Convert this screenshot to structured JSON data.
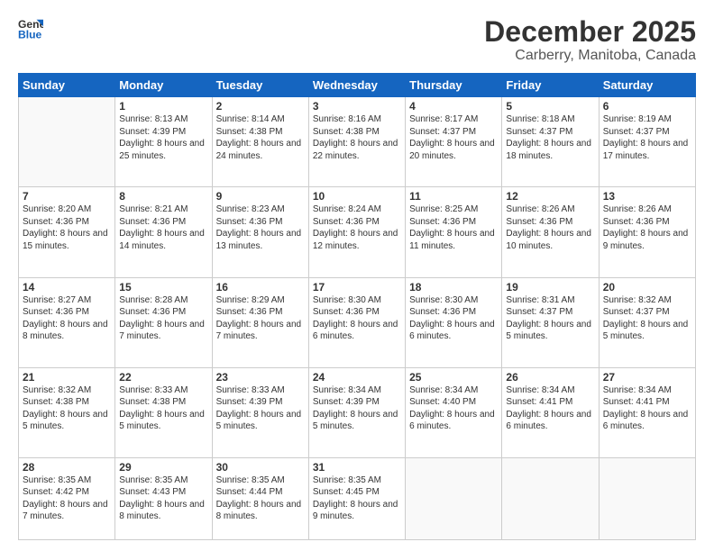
{
  "logo": {
    "line1": "General",
    "line2": "Blue"
  },
  "title": "December 2025",
  "subtitle": "Carberry, Manitoba, Canada",
  "weekdays": [
    "Sunday",
    "Monday",
    "Tuesday",
    "Wednesday",
    "Thursday",
    "Friday",
    "Saturday"
  ],
  "weeks": [
    [
      {
        "day": "",
        "sunrise": "",
        "sunset": "",
        "daylight": ""
      },
      {
        "day": "1",
        "sunrise": "Sunrise: 8:13 AM",
        "sunset": "Sunset: 4:39 PM",
        "daylight": "Daylight: 8 hours and 25 minutes."
      },
      {
        "day": "2",
        "sunrise": "Sunrise: 8:14 AM",
        "sunset": "Sunset: 4:38 PM",
        "daylight": "Daylight: 8 hours and 24 minutes."
      },
      {
        "day": "3",
        "sunrise": "Sunrise: 8:16 AM",
        "sunset": "Sunset: 4:38 PM",
        "daylight": "Daylight: 8 hours and 22 minutes."
      },
      {
        "day": "4",
        "sunrise": "Sunrise: 8:17 AM",
        "sunset": "Sunset: 4:37 PM",
        "daylight": "Daylight: 8 hours and 20 minutes."
      },
      {
        "day": "5",
        "sunrise": "Sunrise: 8:18 AM",
        "sunset": "Sunset: 4:37 PM",
        "daylight": "Daylight: 8 hours and 18 minutes."
      },
      {
        "day": "6",
        "sunrise": "Sunrise: 8:19 AM",
        "sunset": "Sunset: 4:37 PM",
        "daylight": "Daylight: 8 hours and 17 minutes."
      }
    ],
    [
      {
        "day": "7",
        "sunrise": "Sunrise: 8:20 AM",
        "sunset": "Sunset: 4:36 PM",
        "daylight": "Daylight: 8 hours and 15 minutes."
      },
      {
        "day": "8",
        "sunrise": "Sunrise: 8:21 AM",
        "sunset": "Sunset: 4:36 PM",
        "daylight": "Daylight: 8 hours and 14 minutes."
      },
      {
        "day": "9",
        "sunrise": "Sunrise: 8:23 AM",
        "sunset": "Sunset: 4:36 PM",
        "daylight": "Daylight: 8 hours and 13 minutes."
      },
      {
        "day": "10",
        "sunrise": "Sunrise: 8:24 AM",
        "sunset": "Sunset: 4:36 PM",
        "daylight": "Daylight: 8 hours and 12 minutes."
      },
      {
        "day": "11",
        "sunrise": "Sunrise: 8:25 AM",
        "sunset": "Sunset: 4:36 PM",
        "daylight": "Daylight: 8 hours and 11 minutes."
      },
      {
        "day": "12",
        "sunrise": "Sunrise: 8:26 AM",
        "sunset": "Sunset: 4:36 PM",
        "daylight": "Daylight: 8 hours and 10 minutes."
      },
      {
        "day": "13",
        "sunrise": "Sunrise: 8:26 AM",
        "sunset": "Sunset: 4:36 PM",
        "daylight": "Daylight: 8 hours and 9 minutes."
      }
    ],
    [
      {
        "day": "14",
        "sunrise": "Sunrise: 8:27 AM",
        "sunset": "Sunset: 4:36 PM",
        "daylight": "Daylight: 8 hours and 8 minutes."
      },
      {
        "day": "15",
        "sunrise": "Sunrise: 8:28 AM",
        "sunset": "Sunset: 4:36 PM",
        "daylight": "Daylight: 8 hours and 7 minutes."
      },
      {
        "day": "16",
        "sunrise": "Sunrise: 8:29 AM",
        "sunset": "Sunset: 4:36 PM",
        "daylight": "Daylight: 8 hours and 7 minutes."
      },
      {
        "day": "17",
        "sunrise": "Sunrise: 8:30 AM",
        "sunset": "Sunset: 4:36 PM",
        "daylight": "Daylight: 8 hours and 6 minutes."
      },
      {
        "day": "18",
        "sunrise": "Sunrise: 8:30 AM",
        "sunset": "Sunset: 4:36 PM",
        "daylight": "Daylight: 8 hours and 6 minutes."
      },
      {
        "day": "19",
        "sunrise": "Sunrise: 8:31 AM",
        "sunset": "Sunset: 4:37 PM",
        "daylight": "Daylight: 8 hours and 5 minutes."
      },
      {
        "day": "20",
        "sunrise": "Sunrise: 8:32 AM",
        "sunset": "Sunset: 4:37 PM",
        "daylight": "Daylight: 8 hours and 5 minutes."
      }
    ],
    [
      {
        "day": "21",
        "sunrise": "Sunrise: 8:32 AM",
        "sunset": "Sunset: 4:38 PM",
        "daylight": "Daylight: 8 hours and 5 minutes."
      },
      {
        "day": "22",
        "sunrise": "Sunrise: 8:33 AM",
        "sunset": "Sunset: 4:38 PM",
        "daylight": "Daylight: 8 hours and 5 minutes."
      },
      {
        "day": "23",
        "sunrise": "Sunrise: 8:33 AM",
        "sunset": "Sunset: 4:39 PM",
        "daylight": "Daylight: 8 hours and 5 minutes."
      },
      {
        "day": "24",
        "sunrise": "Sunrise: 8:34 AM",
        "sunset": "Sunset: 4:39 PM",
        "daylight": "Daylight: 8 hours and 5 minutes."
      },
      {
        "day": "25",
        "sunrise": "Sunrise: 8:34 AM",
        "sunset": "Sunset: 4:40 PM",
        "daylight": "Daylight: 8 hours and 6 minutes."
      },
      {
        "day": "26",
        "sunrise": "Sunrise: 8:34 AM",
        "sunset": "Sunset: 4:41 PM",
        "daylight": "Daylight: 8 hours and 6 minutes."
      },
      {
        "day": "27",
        "sunrise": "Sunrise: 8:34 AM",
        "sunset": "Sunset: 4:41 PM",
        "daylight": "Daylight: 8 hours and 6 minutes."
      }
    ],
    [
      {
        "day": "28",
        "sunrise": "Sunrise: 8:35 AM",
        "sunset": "Sunset: 4:42 PM",
        "daylight": "Daylight: 8 hours and 7 minutes."
      },
      {
        "day": "29",
        "sunrise": "Sunrise: 8:35 AM",
        "sunset": "Sunset: 4:43 PM",
        "daylight": "Daylight: 8 hours and 8 minutes."
      },
      {
        "day": "30",
        "sunrise": "Sunrise: 8:35 AM",
        "sunset": "Sunset: 4:44 PM",
        "daylight": "Daylight: 8 hours and 8 minutes."
      },
      {
        "day": "31",
        "sunrise": "Sunrise: 8:35 AM",
        "sunset": "Sunset: 4:45 PM",
        "daylight": "Daylight: 8 hours and 9 minutes."
      },
      {
        "day": "",
        "sunrise": "",
        "sunset": "",
        "daylight": ""
      },
      {
        "day": "",
        "sunrise": "",
        "sunset": "",
        "daylight": ""
      },
      {
        "day": "",
        "sunrise": "",
        "sunset": "",
        "daylight": ""
      }
    ]
  ]
}
